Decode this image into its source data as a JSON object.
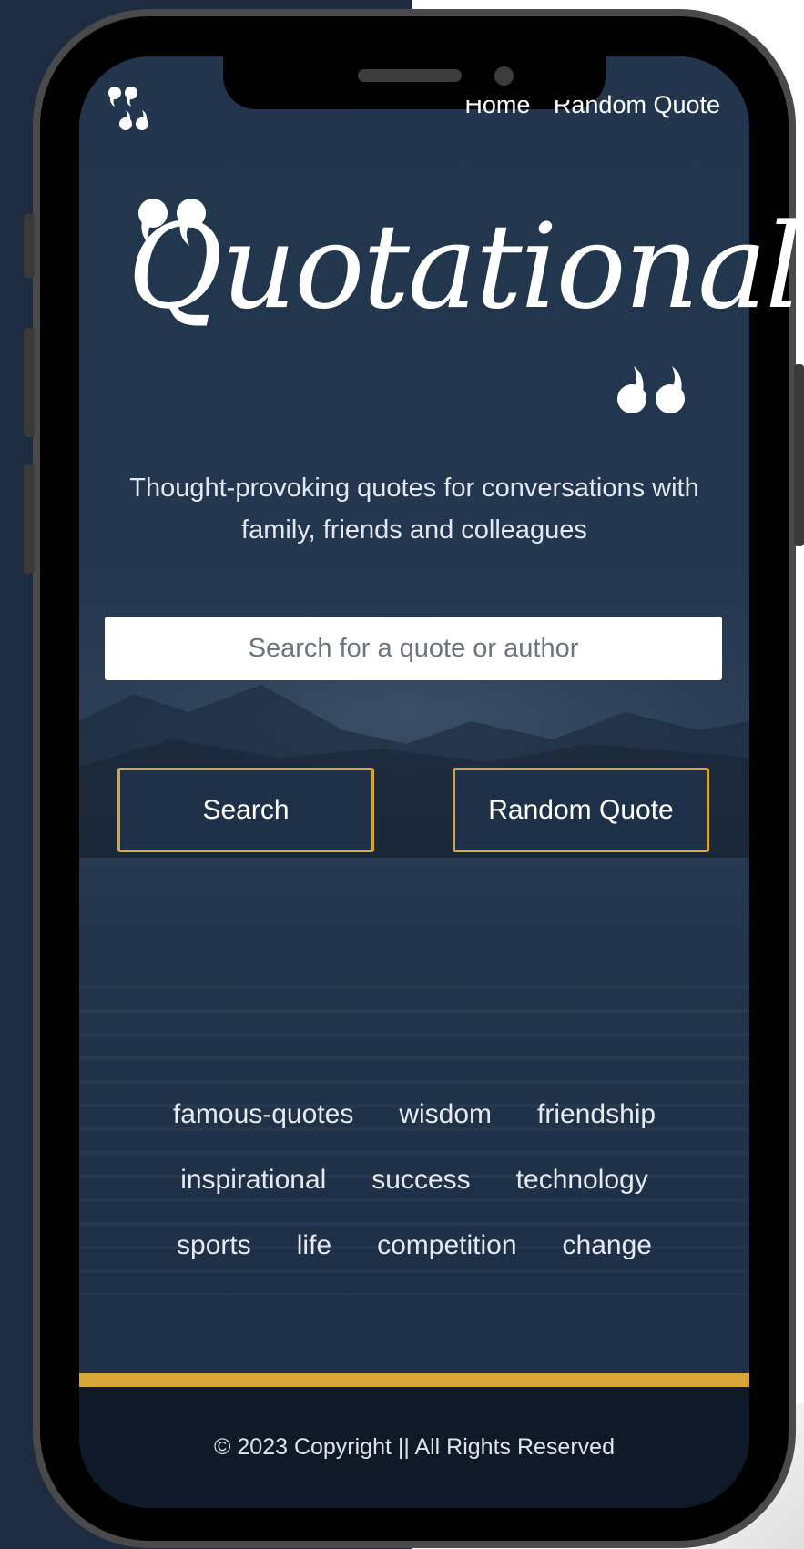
{
  "nav": {
    "links": [
      "Home",
      "Random Quote"
    ],
    "logo_icon": "quote-marks-icon"
  },
  "hero": {
    "logo_text": "Quotational",
    "tagline_line1": "Thought-provoking quotes for conversations with",
    "tagline_line2": "family, friends and colleagues"
  },
  "search": {
    "placeholder": "Search for a quote or author",
    "search_button": "Search",
    "random_button": "Random Quote"
  },
  "tags": {
    "row1": [
      "famous-quotes",
      "wisdom",
      "friendship"
    ],
    "row2": [
      "inspirational",
      "success",
      "technology"
    ],
    "row3": [
      "sports",
      "life",
      "competition",
      "change"
    ]
  },
  "footer": {
    "copyright": "© 2023 Copyright || All Rights Reserved"
  },
  "colors": {
    "background": "#1f3149",
    "accent": "#d8a537",
    "footer": "#0f1a28",
    "text": "#ffffff"
  }
}
